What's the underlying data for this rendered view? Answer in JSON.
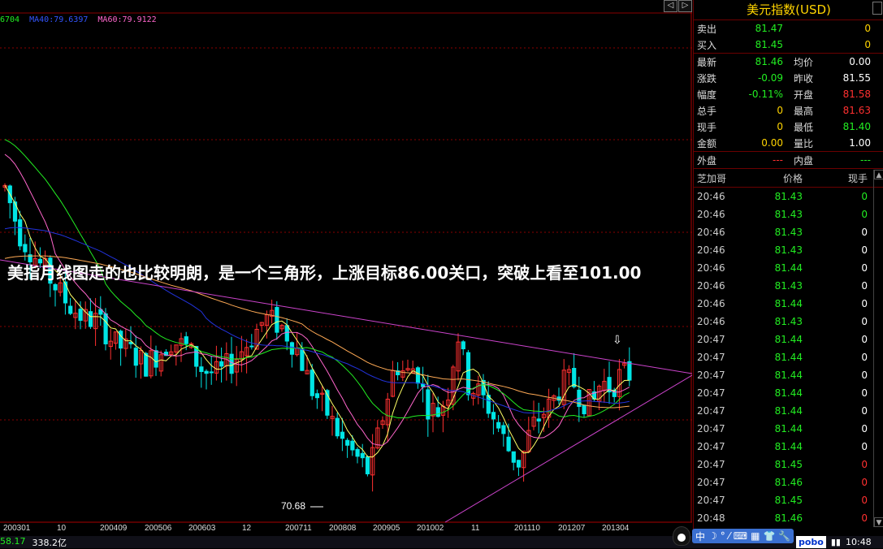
{
  "chart": {
    "ma_legend": [
      {
        "text": "6704",
        "color": "#22ee22"
      },
      {
        "text": "MA40:79.6397",
        "color": "#3355ff"
      },
      {
        "text": "MA60:79.9122",
        "color": "#ff66cc"
      }
    ],
    "caption": "美指月线图走的也比较明朗，是一个三角形，上涨目标86.00关口，突破上看至101.00",
    "low_label": "70.68",
    "arrow": "⇩",
    "nav_prev": "◁",
    "nav_next": "▷",
    "x_labels": [
      "200301",
      "10",
      "200409",
      "200506",
      "200603",
      "12",
      "200711",
      "200808",
      "200905",
      "201002",
      "11",
      "201110",
      "201207",
      "201304"
    ],
    "colors": {
      "up": "#ff3030",
      "down": "#00e5e5",
      "ma_short": "#ffff66",
      "ma_mid": "#ff66cc",
      "ma_green": "#22ee22",
      "ma_blue": "#2233dd",
      "ma_orange": "#ffaa55",
      "grid": "#8a0000"
    }
  },
  "chart_data": {
    "type": "candlestick",
    "title": "",
    "y_range": [
      69,
      93
    ],
    "low_annotation": 70.68,
    "candles_path_knots": [
      [
        0,
        90.8
      ],
      [
        6,
        87.5
      ],
      [
        12,
        86.0
      ],
      [
        18,
        84.5
      ],
      [
        24,
        83.0
      ],
      [
        30,
        82.0
      ],
      [
        36,
        81.8
      ],
      [
        42,
        80.3
      ],
      [
        48,
        79.8
      ],
      [
        54,
        78.9
      ],
      [
        60,
        79.8
      ],
      [
        64,
        80.5
      ],
      [
        70,
        80.0
      ],
      [
        76,
        78.5
      ],
      [
        82,
        78.2
      ],
      [
        88,
        79.2
      ],
      [
        94,
        80.5
      ],
      [
        100,
        82.0
      ],
      [
        106,
        81.5
      ],
      [
        112,
        80.0
      ],
      [
        118,
        77.2
      ],
      [
        124,
        75.6
      ],
      [
        130,
        73.6
      ],
      [
        136,
        72.5
      ],
      [
        140,
        71.6
      ],
      [
        146,
        76.0
      ],
      [
        150,
        79.0
      ],
      [
        154,
        78.2
      ],
      [
        158,
        78.8
      ],
      [
        162,
        76.2
      ],
      [
        166,
        75.6
      ],
      [
        170,
        76.8
      ],
      [
        174,
        81.0
      ],
      [
        178,
        77.5
      ],
      [
        182,
        77.0
      ],
      [
        186,
        76.0
      ],
      [
        190,
        74.5
      ],
      [
        194,
        73.0
      ],
      [
        198,
        72.2
      ],
      [
        202,
        74.5
      ],
      [
        206,
        75.5
      ],
      [
        210,
        76.2
      ],
      [
        214,
        77.6
      ],
      [
        218,
        77.8
      ],
      [
        222,
        76.5
      ],
      [
        226,
        76.2
      ],
      [
        229,
        77.8
      ],
      [
        233,
        77.3
      ],
      [
        237,
        78.3
      ],
      [
        240,
        78.2
      ]
    ],
    "ma_series_names": []
  },
  "quote": {
    "title": "美元指数(USD)",
    "rows": [
      {
        "l1": "卖出",
        "v1": "81.47",
        "v1c": "green",
        "l2": "",
        "v2": "0",
        "v2c": "yellow"
      },
      {
        "l1": "买入",
        "v1": "81.45",
        "v1c": "green",
        "l2": "",
        "v2": "0",
        "v2c": "yellow"
      },
      {
        "l1": "最新",
        "v1": "81.46",
        "v1c": "green",
        "l2": "均价",
        "v2": "0.00",
        "v2c": "white"
      },
      {
        "l1": "涨跌",
        "v1": "-0.09",
        "v1c": "green",
        "l2": "昨收",
        "v2": "81.55",
        "v2c": "white"
      },
      {
        "l1": "幅度",
        "v1": "-0.11%",
        "v1c": "green",
        "l2": "开盘",
        "v2": "81.58",
        "v2c": "red"
      },
      {
        "l1": "总手",
        "v1": "0",
        "v1c": "yellow",
        "l2": "最高",
        "v2": "81.63",
        "v2c": "red"
      },
      {
        "l1": "现手",
        "v1": "0",
        "v1c": "yellow",
        "l2": "最低",
        "v2": "81.40",
        "v2c": "green"
      },
      {
        "l1": "金额",
        "v1": "0.00",
        "v1c": "yellow",
        "l2": "量比",
        "v2": "1.00",
        "v2c": "white"
      },
      {
        "l1": "外盘",
        "v1": "---",
        "v1c": "red",
        "l2": "内盘",
        "v2": "---",
        "v2c": "green"
      }
    ],
    "tick_header": {
      "a": "芝加哥",
      "b": "价格",
      "c": "现手"
    },
    "ticks": [
      {
        "t": "20:46",
        "p": "81.43",
        "v": "0",
        "vc": "green"
      },
      {
        "t": "20:46",
        "p": "81.43",
        "v": "0",
        "vc": "green"
      },
      {
        "t": "20:46",
        "p": "81.43",
        "v": "0",
        "vc": "white"
      },
      {
        "t": "20:46",
        "p": "81.43",
        "v": "0",
        "vc": "white"
      },
      {
        "t": "20:46",
        "p": "81.44",
        "v": "0",
        "vc": "white"
      },
      {
        "t": "20:46",
        "p": "81.43",
        "v": "0",
        "vc": "white"
      },
      {
        "t": "20:46",
        "p": "81.44",
        "v": "0",
        "vc": "white"
      },
      {
        "t": "20:46",
        "p": "81.43",
        "v": "0",
        "vc": "white"
      },
      {
        "t": "20:47",
        "p": "81.44",
        "v": "0",
        "vc": "white"
      },
      {
        "t": "20:47",
        "p": "81.44",
        "v": "0",
        "vc": "white"
      },
      {
        "t": "20:47",
        "p": "81.44",
        "v": "0",
        "vc": "white"
      },
      {
        "t": "20:47",
        "p": "81.44",
        "v": "0",
        "vc": "white"
      },
      {
        "t": "20:47",
        "p": "81.44",
        "v": "0",
        "vc": "white"
      },
      {
        "t": "20:47",
        "p": "81.44",
        "v": "0",
        "vc": "white"
      },
      {
        "t": "20:47",
        "p": "81.44",
        "v": "0",
        "vc": "white"
      },
      {
        "t": "20:47",
        "p": "81.45",
        "v": "0",
        "vc": "red"
      },
      {
        "t": "20:47",
        "p": "81.46",
        "v": "0",
        "vc": "red"
      },
      {
        "t": "20:47",
        "p": "81.45",
        "v": "0",
        "vc": "red"
      },
      {
        "t": "20:48",
        "p": "81.46",
        "v": "0",
        "vc": "red"
      }
    ]
  },
  "taskbar": {
    "v1": "58.17",
    "v2": "338.2亿",
    "ime_char": "中",
    "ime_icons": [
      "☽",
      "°",
      "⁄",
      "⌨",
      "▦",
      "👕",
      "🔧"
    ],
    "app": "pobo",
    "clock": "10:48"
  }
}
